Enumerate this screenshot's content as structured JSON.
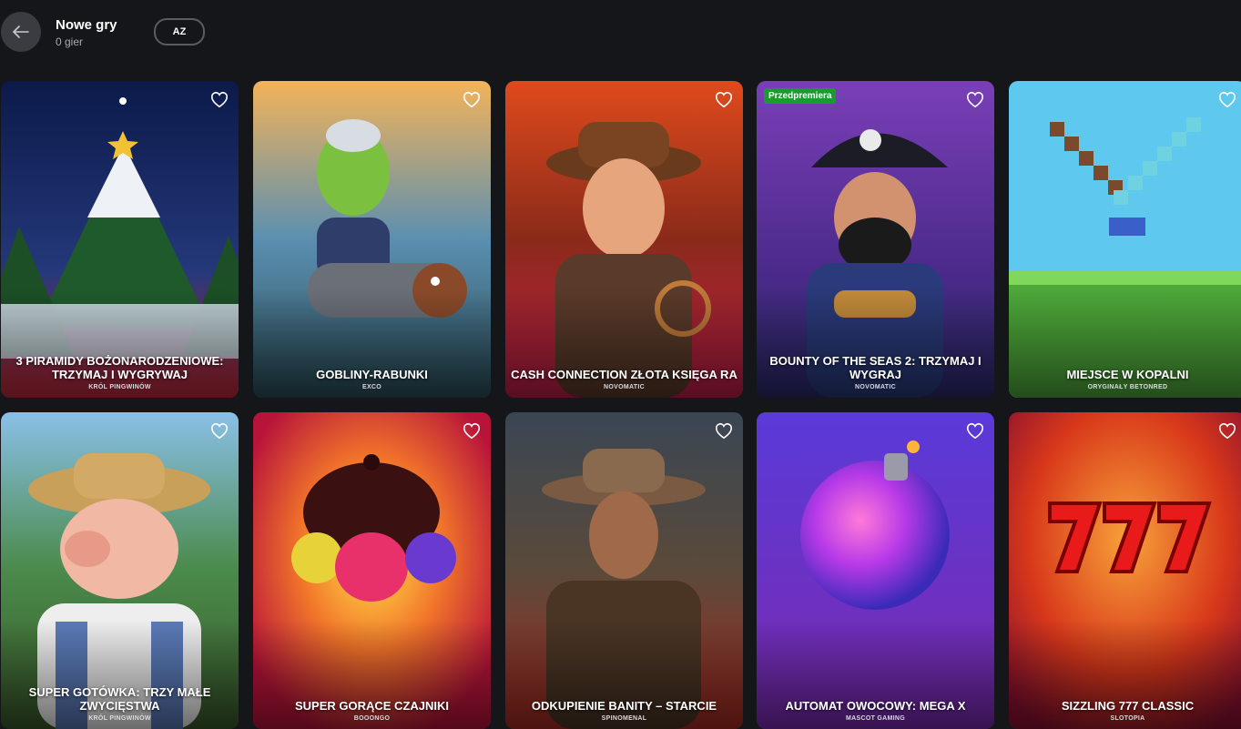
{
  "header": {
    "title": "Nowe gry",
    "count": "0 gier",
    "sort_label": "AZ"
  },
  "games": [
    {
      "name": "3 PIRAMIDY BOŻONARODZENIOWE: TRZYMAJ I WYGRYWAJ",
      "provider": "KRÓL PINGWINÓW",
      "badge": ""
    },
    {
      "name": "GOBLINY-RABUNKI",
      "provider": "EXCO",
      "badge": ""
    },
    {
      "name": "CASH CONNECTION ZŁOTA KSIĘGA RA",
      "provider": "NOVOMATIC",
      "badge": ""
    },
    {
      "name": "BOUNTY OF THE SEAS 2: TRZYMAJ I WYGRAJ",
      "provider": "NOVOMATIC",
      "badge": "Przedpremiera"
    },
    {
      "name": "MIEJSCE W KOPALNI",
      "provider": "ORYGINAŁY BETONRED",
      "badge": ""
    },
    {
      "name": "SUPER GOTÓWKA: TRZY MAŁE ZWYCIĘSTWA",
      "provider": "KRÓL PINGWINÓW",
      "badge": ""
    },
    {
      "name": "SUPER GORĄCE CZAJNIKI",
      "provider": "BOOONGO",
      "badge": ""
    },
    {
      "name": "ODKUPIENIE BANITY – STARCIE",
      "provider": "SPINOMENAL",
      "badge": ""
    },
    {
      "name": "AUTOMAT OWOCOWY: MEGA X",
      "provider": "MASCOT GAMING",
      "badge": ""
    },
    {
      "name": "SIZZLING 777 CLASSIC",
      "provider": "SLOTOPIA",
      "badge": ""
    }
  ],
  "icons": {
    "back": "arrow-left-icon",
    "favorite": "heart-outline-icon"
  }
}
